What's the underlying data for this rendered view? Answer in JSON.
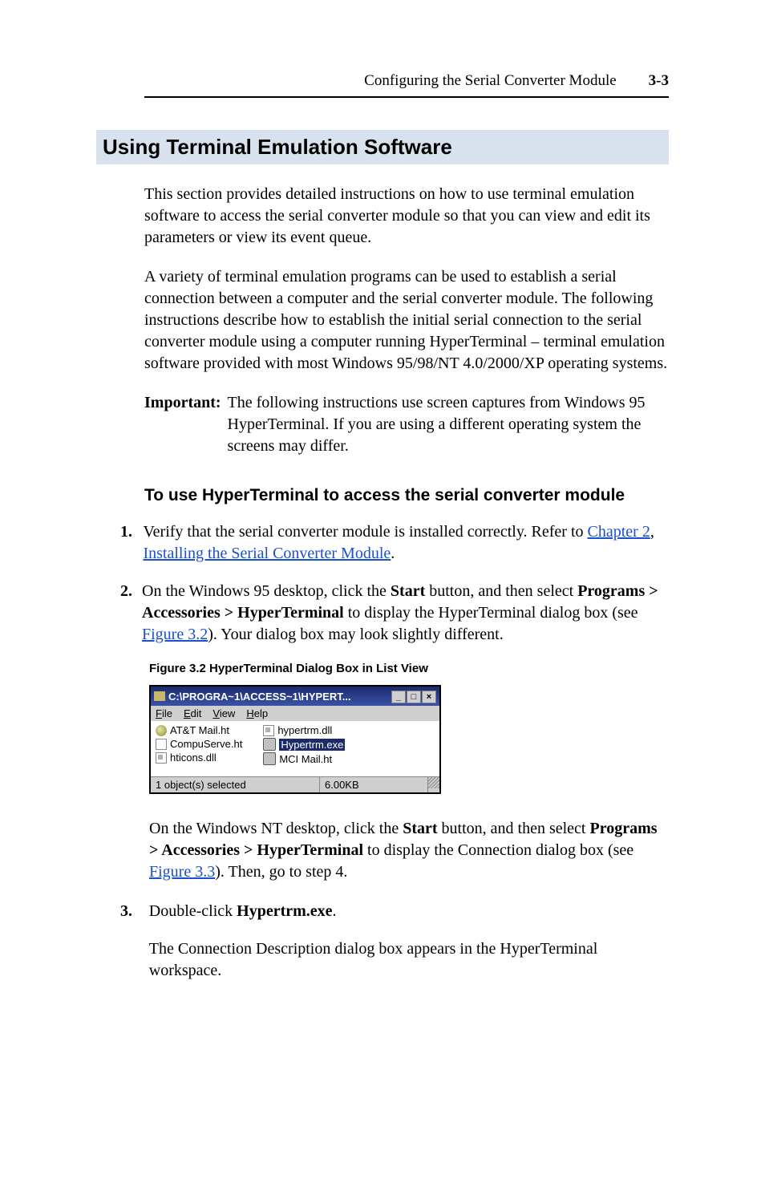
{
  "header": {
    "title": "Configuring the Serial Converter Module",
    "page_num": "3-3"
  },
  "h1": "Using Terminal Emulation Software",
  "para1": "This section provides detailed instructions on how to use terminal emulation software to access the serial converter module so that you can view and edit its parameters or view its event queue.",
  "para2": "A variety of terminal emulation programs can be used to establish a serial connection between a computer and the serial converter module. The following instructions describe how to establish the initial serial connection to the serial converter module using a computer running HyperTerminal – terminal emulation software provided with most Windows 95/98/NT 4.0/2000/XP operating systems.",
  "important": {
    "label": "Important:",
    "text": "The following instructions use screen captures from Windows 95 HyperTerminal. If you are using a different operating system the screens may differ."
  },
  "h2": "To use HyperTerminal to access the serial converter module",
  "steps": {
    "s1_num": "1.",
    "s1a": "Verify that the serial converter module is installed correctly. Refer to ",
    "s1_link1": "Chapter 2",
    "s1_mid": ", ",
    "s1_link2": "Installing the Serial Converter Module",
    "s1_end": ".",
    "s2_num": "2.",
    "s2a": "On the Windows 95 desktop, click the ",
    "s2_start": "Start",
    "s2b": " button, and then select ",
    "s2_path": "Programs > Accessories > HyperTerminal",
    "s2c": " to display the HyperTerminal dialog box (see ",
    "s2_fig": "Figure 3.2",
    "s2d": "). Your dialog box may look slightly different.",
    "nt_a": "On the Windows NT desktop, click the ",
    "nt_start": "Start",
    "nt_b": " button, and then select ",
    "nt_path": "Programs > Accessories > HyperTerminal",
    "nt_c": " to display the Connection dialog box (see ",
    "nt_fig": "Figure 3.3",
    "nt_d": "). Then, go to step 4.",
    "s3_num": "3.",
    "s3a": "Double-click ",
    "s3_bold": "Hypertrm.exe",
    "s3b": ".",
    "s3_after": "The Connection Description dialog box appears in the HyperTerminal workspace."
  },
  "figure": {
    "caption": "Figure 3.2   HyperTerminal Dialog Box in List View",
    "title": "C:\\PROGRA~1\\ACCESS~1\\HYPERT...",
    "menu": {
      "file": "File",
      "edit": "Edit",
      "view": "View",
      "help": "Help"
    },
    "files": {
      "att": "AT&T Mail.ht",
      "compu": "CompuServe.ht",
      "hticons": "hticons.dll",
      "hypdll": "hypertrm.dll",
      "hypexe": "Hypertrm.exe",
      "mci": "MCI Mail.ht"
    },
    "status": {
      "left": "1 object(s) selected",
      "right": "6.00KB"
    },
    "buttons": {
      "min": "_",
      "max": "□",
      "close": "×"
    }
  }
}
